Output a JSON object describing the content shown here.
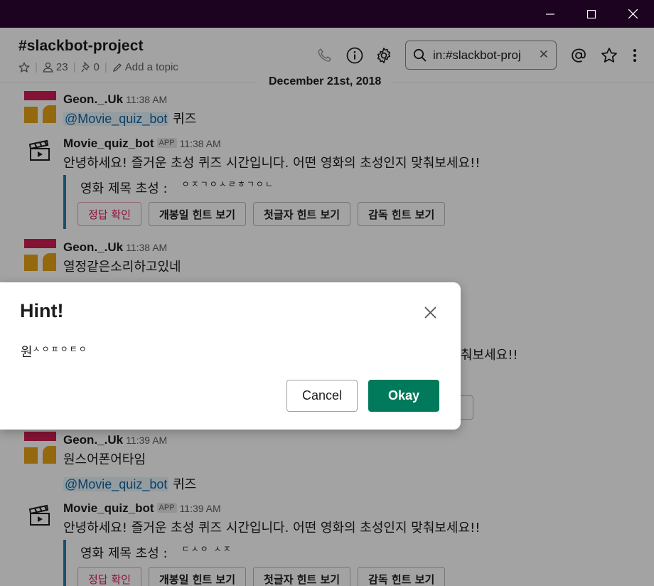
{
  "window": {
    "minimize_icon": "minimize-icon",
    "maximize_icon": "maximize-icon",
    "close_icon": "close-icon"
  },
  "channel": {
    "name": "#slackbot-project",
    "members": "23",
    "pins": "0",
    "add_topic": "Add a topic"
  },
  "search": {
    "value": "in:#slackbot-proj"
  },
  "date_divider": "December 21st, 2018",
  "messages": [
    {
      "author": "Geon._.Uk",
      "time": "11:38 AM",
      "mention": "@Movie_quiz_bot",
      "text": "퀴즈"
    },
    {
      "author": "Movie_quiz_bot",
      "badge": "APP",
      "time": "11:38 AM",
      "text": "안녕하세요! 즐거운 초성 퀴즈 시간입니다. 어떤 영화의 초성인지 맞춰보세요!!",
      "field_label": "영화 제목 초성 :",
      "field_value": "ㅇㅈㄱㅇㅅㄹㅎㄱㅇㄴ",
      "buttons": [
        "정답 확인",
        "개봉일 힌트 보기",
        "첫글자 힌트 보기",
        "감독 힌트 보기"
      ]
    },
    {
      "author": "Geon._.Uk",
      "time": "11:38 AM",
      "text": "열정같은소리하고있네"
    },
    {
      "author": "Geon._.Uk",
      "time": "11:39 AM",
      "text": "원스어폰어타임",
      "mention": "@Movie_quiz_bot",
      "text2": "퀴즈"
    },
    {
      "author": "Movie_quiz_bot",
      "badge": "APP",
      "time": "11:39 AM",
      "text": "안녕하세요! 즐거운 초성 퀴즈 시간입니다. 어떤 영화의 초성인지 맞춰보세요!!",
      "field_label": "영화 제목 초성 :",
      "field_value": "ㄷㅅㅇ ㅅㅈ",
      "buttons": [
        "정답 확인",
        "개봉일 힌트 보기",
        "첫글자 힌트 보기",
        "감독 힌트 보기"
      ]
    }
  ],
  "hidden_partial": {
    "text_tail": "춰보세요!!"
  },
  "modal": {
    "title": "Hint!",
    "text_first": "원",
    "text_rest": "ㅅㅇㅍㅇㅌㅇ",
    "cancel": "Cancel",
    "okay": "Okay"
  },
  "colors": {
    "titlebar": "#1c0320",
    "accent_green": "#007a5a",
    "link": "#1264a3",
    "danger": "#e01e5a",
    "attachment_bar": "#2b7cb0"
  }
}
